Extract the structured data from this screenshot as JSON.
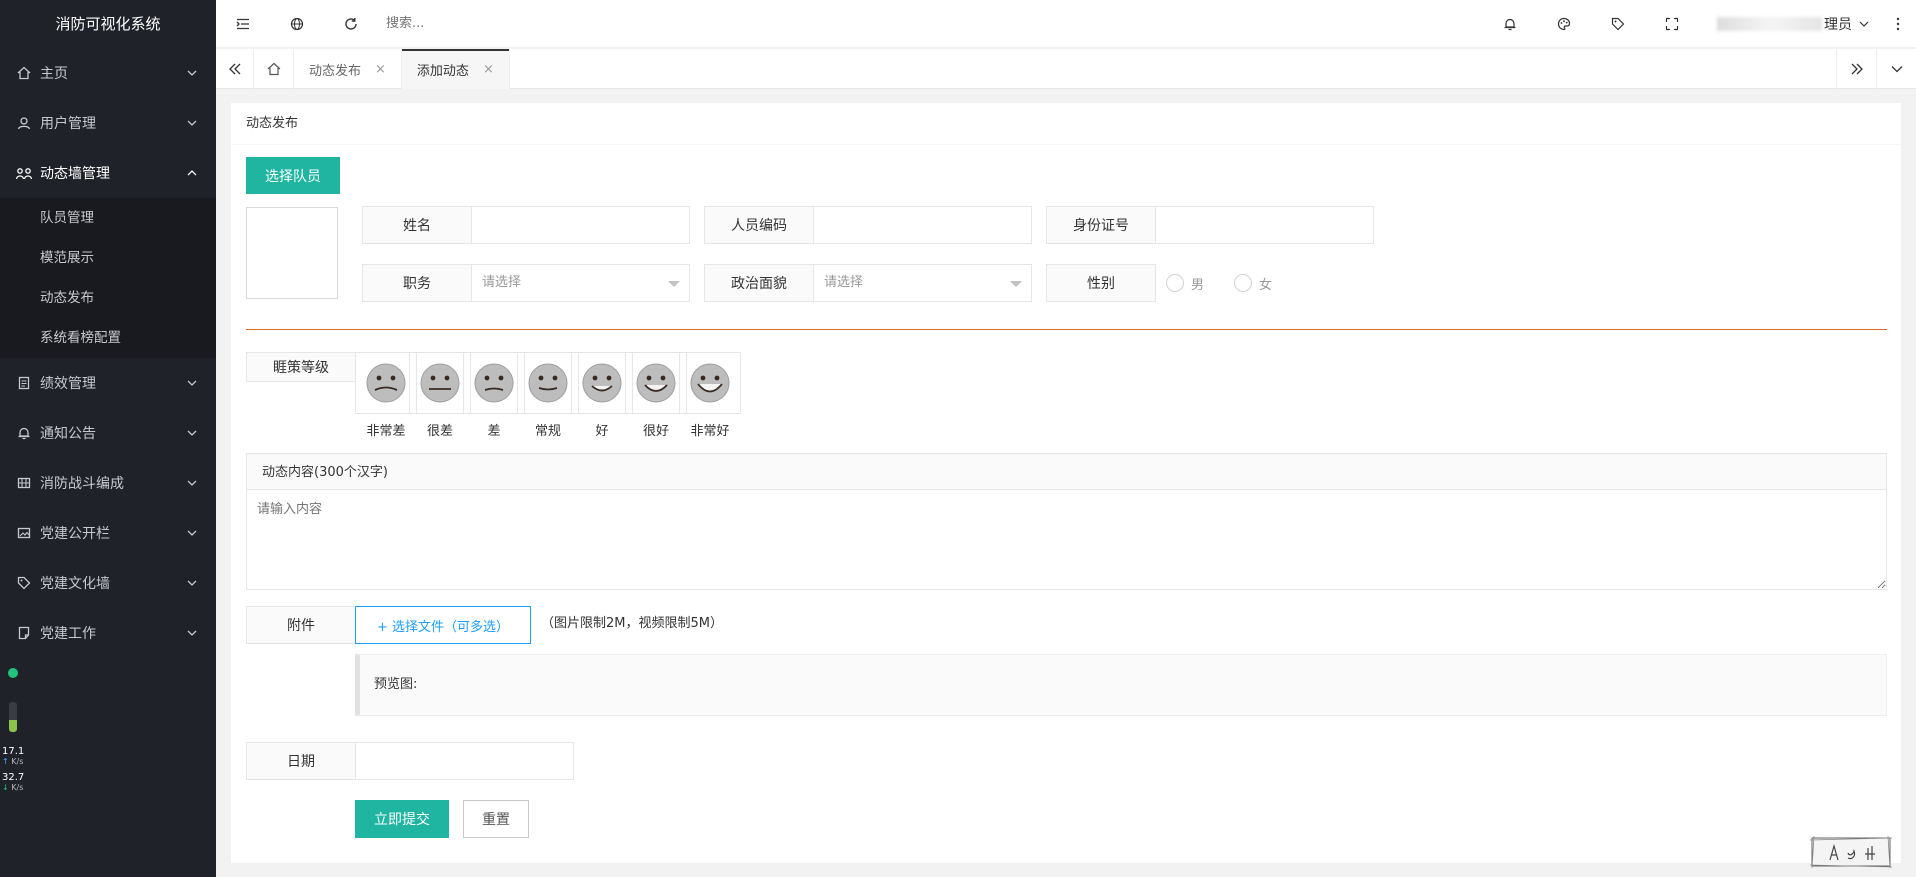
{
  "app": {
    "title": "消防可视化系统"
  },
  "sidebar": {
    "menu": [
      {
        "label": "主页",
        "icon": "home-icon"
      },
      {
        "label": "用户管理",
        "icon": "user-icon"
      },
      {
        "label": "动态墙管理",
        "icon": "group-icon",
        "open": true
      },
      {
        "label": "绩效管理",
        "icon": "clipboard-icon"
      },
      {
        "label": "通知公告",
        "icon": "bell-icon"
      },
      {
        "label": "消防战斗编成",
        "icon": "grid-icon"
      },
      {
        "label": "党建公开栏",
        "icon": "image-icon"
      },
      {
        "label": "党建文化墙",
        "icon": "tag-icon"
      },
      {
        "label": "党建工作",
        "icon": "note-icon"
      }
    ],
    "submenu": [
      "队员管理",
      "模范展示",
      "动态发布",
      "系统看榜配置"
    ],
    "net": {
      "up": "17.1",
      "up_unit": "K/s",
      "down": "32.7",
      "down_unit": "K/s",
      "level": 0.4
    }
  },
  "topbar": {
    "search_placeholder": "搜索...",
    "user_suffix": "理员"
  },
  "tabs": {
    "items": [
      {
        "label": "动态发布",
        "active": false
      },
      {
        "label": "添加动态",
        "active": true
      }
    ]
  },
  "form": {
    "card_title": "动态发布",
    "select_member": "选择队员",
    "name_label": "姓名",
    "code_label": "人员编码",
    "id_label": "身份证号",
    "duty_label": "职务",
    "duty_placeholder": "请选择",
    "politics_label": "政治面貌",
    "politics_placeholder": "请选择",
    "gender_label": "性别",
    "gender_male": "男",
    "gender_female": "女",
    "rating_label": "睚策等级",
    "ratings": [
      "非常差",
      "很差",
      "差",
      "常规",
      "好",
      "很好",
      "非常好"
    ],
    "content_label": "动态内容(300个汉字)",
    "content_placeholder": "请输入内容",
    "attachment_label": "附件",
    "upload_button": "+ 选择文件（可多选）",
    "upload_note": "（图片限制2M，视频限制5M）",
    "preview_label": "预览图:",
    "date_label": "日期",
    "submit": "立即提交",
    "reset": "重置"
  },
  "colors": {
    "accent": "#1fb5a1",
    "sidebar_bg": "#20222a",
    "divider": "#d96a2a",
    "link": "#1e9fff"
  }
}
